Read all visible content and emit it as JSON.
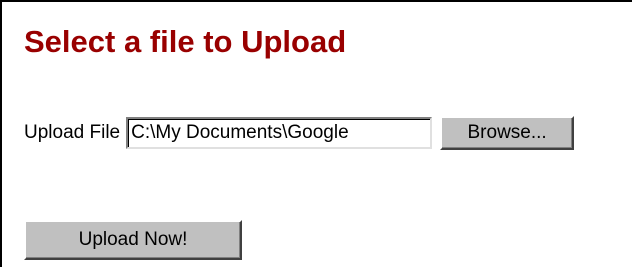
{
  "heading": "Select a file to Upload",
  "upload": {
    "label": "Upload File",
    "file_path_value": "C:\\My Documents\\Google",
    "browse_label": "Browse..."
  },
  "submit_label": "Upload Now!",
  "colors": {
    "heading": "#990000",
    "button_face": "#c0c0c0",
    "background": "#ffffff"
  }
}
